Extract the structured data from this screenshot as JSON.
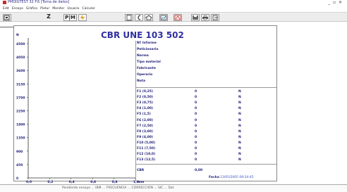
{
  "window": {
    "title": "PMDIGTEST 32 F.6   [Toma de datos]",
    "controls": "_ ▫ ✕"
  },
  "menu": [
    "Edit",
    "Ensayo",
    "Gráfico",
    "Píxtur",
    "Monitor",
    "Usuario",
    "Calcular"
  ],
  "toolbar": {
    "z_label": "Z",
    "pm_label": "P|M"
  },
  "chart": {
    "title": "CBR UNE 103 502",
    "y_unit": "N",
    "x_unit": "mm",
    "y_ticks": [
      "4500",
      "4050",
      "3600",
      "3150",
      "2700",
      "2250",
      "1800",
      "1350",
      "900",
      "450",
      "0"
    ],
    "x_ticks": [
      "0,0",
      "0,2",
      "0,4",
      "0,6",
      "0,8",
      "1,0"
    ]
  },
  "chart_data": {
    "type": "line",
    "title": "CBR UNE 103 502",
    "xlabel": "mm",
    "ylabel": "N",
    "xlim": [
      0,
      1.0
    ],
    "ylim": [
      0,
      4500
    ],
    "series": []
  },
  "info": {
    "fields": [
      "Nº Informe",
      "Peticionario",
      "Norma",
      "Tipo material",
      "Fabricante",
      "Operario",
      "Nota"
    ],
    "readings": [
      {
        "label": "F1  (0,25)",
        "value": "0",
        "unit": "N"
      },
      {
        "label": "F2  (0,50)",
        "value": "0",
        "unit": "N"
      },
      {
        "label": "F3  (0,75)",
        "value": "0",
        "unit": "N"
      },
      {
        "label": "F4  (1,00)",
        "value": "0",
        "unit": "N"
      },
      {
        "label": "F5  (1,5)",
        "value": "0",
        "unit": "N"
      },
      {
        "label": "F6  (2,00)",
        "value": "0",
        "unit": "N"
      },
      {
        "label": "F7  (2,50)",
        "value": "0",
        "unit": "N"
      },
      {
        "label": "F8  (3,00)",
        "value": "0",
        "unit": "N"
      },
      {
        "label": "F9  (4,00)",
        "value": "0",
        "unit": "N"
      },
      {
        "label": "F10 (5,00)",
        "value": "0",
        "unit": "N"
      },
      {
        "label": "F11 (7,50)",
        "value": "0",
        "unit": "N"
      },
      {
        "label": "F12 (10,0)",
        "value": "0",
        "unit": "N"
      },
      {
        "label": "F13 (12,5)",
        "value": "0",
        "unit": "N"
      }
    ],
    "cbr_label": "CBR",
    "cbr_value": "0,00",
    "date_label": "Fecha",
    "date_value": "13/05/2005 09:34:45"
  },
  "status": {
    "text": "Pendiente ensayo ... IBM ... FRECUENCIA ... CORRECCIÓN ... SIC ... Dat"
  }
}
